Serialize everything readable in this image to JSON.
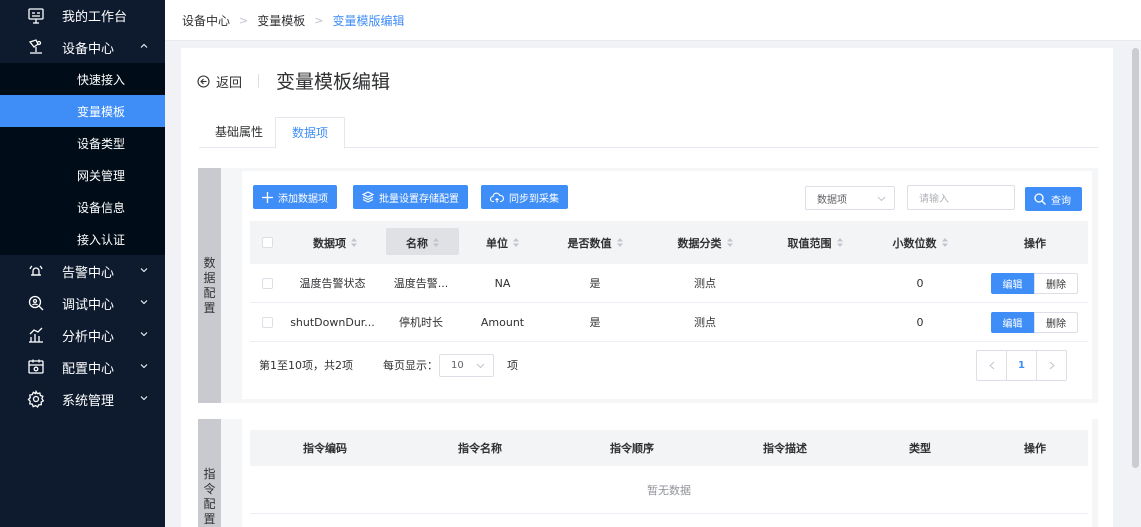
{
  "sidebar": {
    "items": [
      {
        "label": "我的工作台",
        "icon": "monitor-icon"
      },
      {
        "label": "设备中心",
        "icon": "device-icon",
        "expanded": true
      },
      {
        "label": "告警中心",
        "icon": "alarm-icon"
      },
      {
        "label": "调试中心",
        "icon": "debug-icon"
      },
      {
        "label": "分析中心",
        "icon": "chart-icon"
      },
      {
        "label": "配置中心",
        "icon": "config-icon"
      },
      {
        "label": "系统管理",
        "icon": "gear-icon"
      }
    ],
    "sub_items": [
      {
        "label": "快速接入"
      },
      {
        "label": "变量模板",
        "active": true
      },
      {
        "label": "设备类型"
      },
      {
        "label": "网关管理"
      },
      {
        "label": "设备信息"
      },
      {
        "label": "接入认证"
      }
    ]
  },
  "breadcrumb": [
    "设备中心",
    "变量模板",
    "变量模版编辑"
  ],
  "page": {
    "back_label": "返回",
    "title": "变量模板编辑",
    "tabs": [
      "基础属性",
      "数据项"
    ],
    "active_tab": 1
  },
  "data_section": {
    "label_chars": [
      "数",
      "据",
      "配",
      "置"
    ],
    "toolbar": {
      "add_label": "添加数据项",
      "batch_label": "批量设置存储配置",
      "sync_label": "同步到采集",
      "filter_select": "数据项",
      "search_placeholder": "请输入",
      "query_label": "查询"
    },
    "columns": [
      "数据项",
      "名称",
      "单位",
      "是否数值",
      "数据分类",
      "取值范围",
      "小数位数",
      "操作"
    ],
    "rows": [
      {
        "item": "温度告警状态",
        "name": "温度告警...",
        "unit": "NA",
        "numeric": "是",
        "category": "测点",
        "range": "",
        "decimals": "0"
      },
      {
        "item": "shutDownDur...",
        "name": "停机时长",
        "unit": "Amount",
        "numeric": "是",
        "category": "测点",
        "range": "",
        "decimals": "0"
      }
    ],
    "edit_label": "编辑",
    "delete_label": "删除",
    "pagination": {
      "summary": "第1至10项，共2项",
      "page_size_label": "每页显示：",
      "page_size": "10",
      "page_size_unit": "项",
      "current_page": "1"
    }
  },
  "command_section": {
    "label_chars": [
      "指",
      "令",
      "配",
      "置"
    ],
    "columns": [
      "指令编码",
      "指令名称",
      "指令顺序",
      "指令描述",
      "类型",
      "操作"
    ],
    "empty_text": "暂无数据"
  },
  "colors": {
    "primary": "#3f8ef7",
    "sidebar": "#0e1b2f",
    "submenu": "#000c17"
  }
}
